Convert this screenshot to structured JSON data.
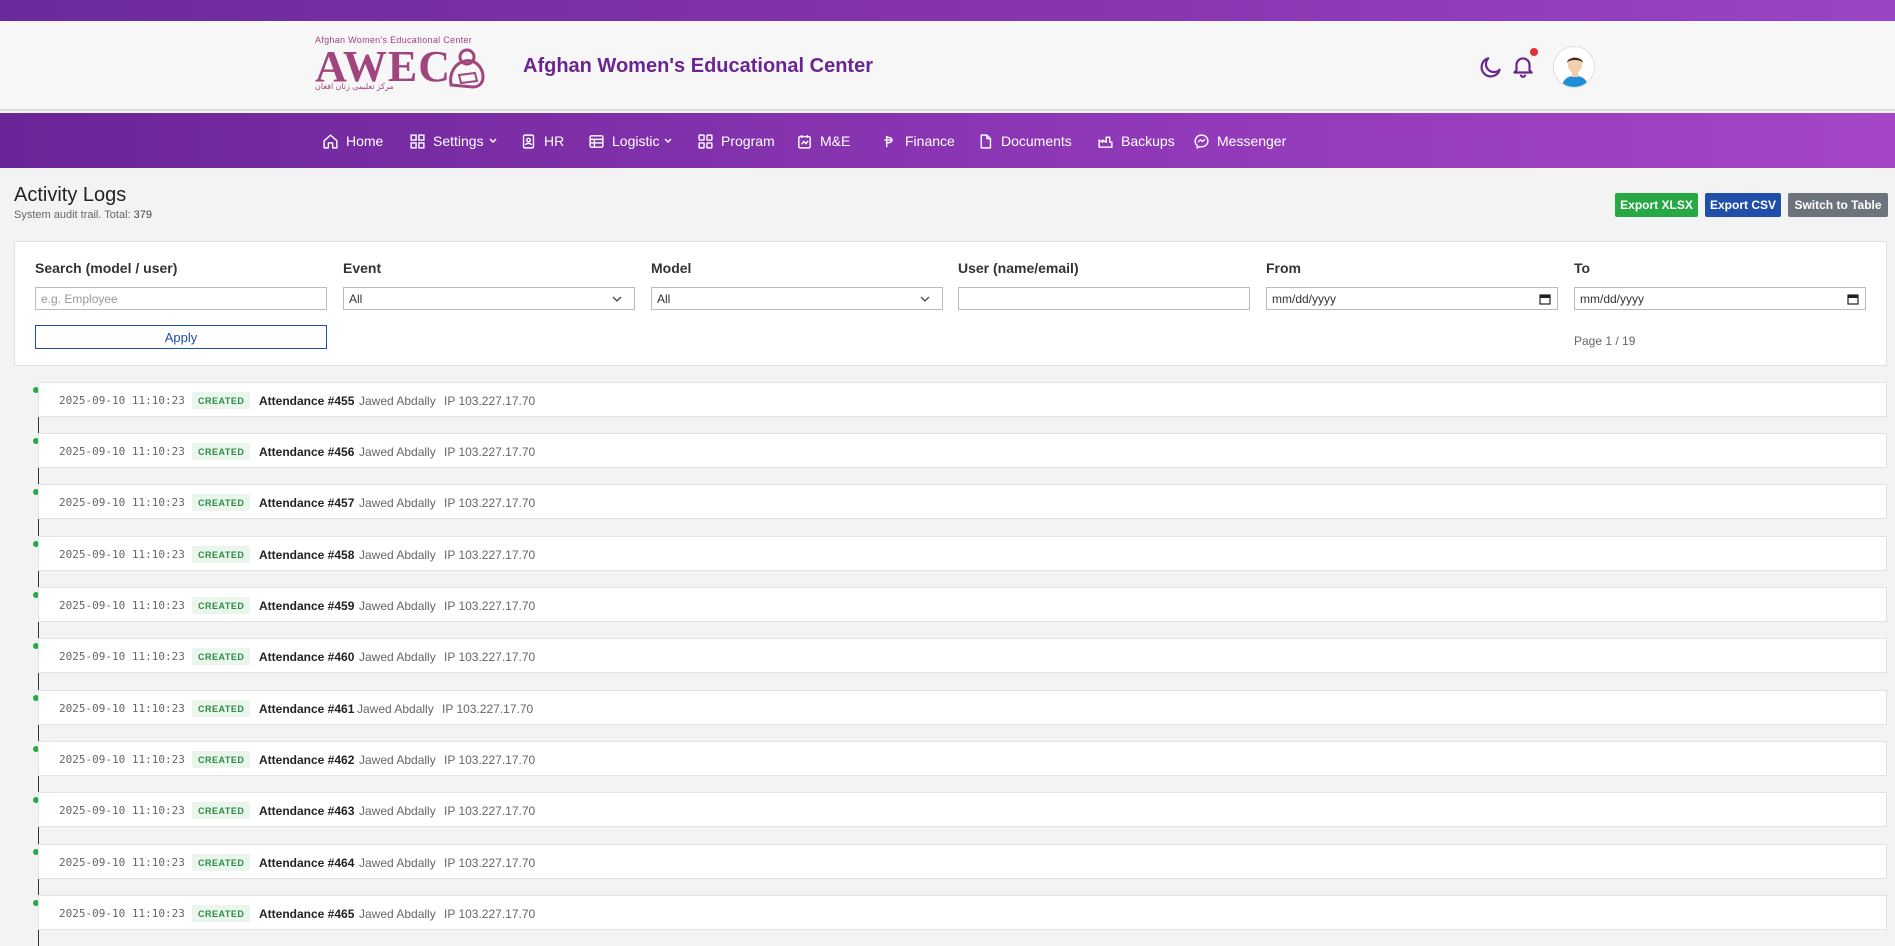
{
  "header": {
    "logo_small": "Afghan Women's Educational Center",
    "logo_big": "AWEC",
    "logo_arabic": "مرکز تعلیمی زنان افغان",
    "org_title": "Afghan Women's Educational Center"
  },
  "nav": [
    {
      "label": "Home",
      "icon": "home-icon"
    },
    {
      "label": "Settings",
      "icon": "grid-icon",
      "dropdown": true
    },
    {
      "label": "HR",
      "icon": "id-card-icon"
    },
    {
      "label": "Logistic",
      "icon": "table-icon",
      "dropdown": true
    },
    {
      "label": "Program",
      "icon": "grid-icon"
    },
    {
      "label": "M&E",
      "icon": "chart-icon"
    },
    {
      "label": "Finance",
      "icon": "currency-icon"
    },
    {
      "label": "Documents",
      "icon": "file-icon"
    },
    {
      "label": "Backups",
      "icon": "backup-icon"
    },
    {
      "label": "Messenger",
      "icon": "messenger-icon"
    }
  ],
  "page": {
    "title": "Activity Logs",
    "subtitle_prefix": "System audit trail. Total: ",
    "total": "379"
  },
  "actions": {
    "export_xlsx": "Export XLSX",
    "export_csv": "Export CSV",
    "switch_table": "Switch to Table"
  },
  "filters": {
    "search_label": "Search (model / user)",
    "search_placeholder": "e.g. Employee",
    "event_label": "Event",
    "event_value": "All",
    "model_label": "Model",
    "model_value": "All",
    "user_label": "User (name/email)",
    "user_value": "",
    "from_label": "From",
    "from_value": "mm/dd/yyyy",
    "to_label": "To",
    "to_value": "mm/dd/yyyy",
    "apply": "Apply",
    "page_info": "Page 1 / 19"
  },
  "logs": [
    {
      "ts": "2025-09-10 11:10:23",
      "event": "CREATED",
      "model": "Attendance #455",
      "user": "Jawed Abdally",
      "ip": "IP 103.227.17.70"
    },
    {
      "ts": "2025-09-10 11:10:23",
      "event": "CREATED",
      "model": "Attendance #456",
      "user": "Jawed Abdally",
      "ip": "IP 103.227.17.70"
    },
    {
      "ts": "2025-09-10 11:10:23",
      "event": "CREATED",
      "model": "Attendance #457",
      "user": "Jawed Abdally",
      "ip": "IP 103.227.17.70"
    },
    {
      "ts": "2025-09-10 11:10:23",
      "event": "CREATED",
      "model": "Attendance #458",
      "user": "Jawed Abdally",
      "ip": "IP 103.227.17.70"
    },
    {
      "ts": "2025-09-10 11:10:23",
      "event": "CREATED",
      "model": "Attendance #459",
      "user": "Jawed Abdally",
      "ip": "IP 103.227.17.70"
    },
    {
      "ts": "2025-09-10 11:10:23",
      "event": "CREATED",
      "model": "Attendance #460",
      "user": "Jawed Abdally",
      "ip": "IP 103.227.17.70"
    },
    {
      "ts": "2025-09-10 11:10:23",
      "event": "CREATED",
      "model": "Attendance #461",
      "user": "Jawed Abdally",
      "ip": "IP 103.227.17.70"
    },
    {
      "ts": "2025-09-10 11:10:23",
      "event": "CREATED",
      "model": "Attendance #462",
      "user": "Jawed Abdally",
      "ip": "IP 103.227.17.70"
    },
    {
      "ts": "2025-09-10 11:10:23",
      "event": "CREATED",
      "model": "Attendance #463",
      "user": "Jawed Abdally",
      "ip": "IP 103.227.17.70"
    },
    {
      "ts": "2025-09-10 11:10:23",
      "event": "CREATED",
      "model": "Attendance #464",
      "user": "Jawed Abdally",
      "ip": "IP 103.227.17.70"
    },
    {
      "ts": "2025-09-10 11:10:23",
      "event": "CREATED",
      "model": "Attendance #465",
      "user": "Jawed Abdally",
      "ip": "IP 103.227.17.70"
    }
  ],
  "colors": {
    "brand_purple": "#6b2590",
    "success_green": "#28a745",
    "primary_blue": "#1f4fa8",
    "secondary_gray": "#6c757d"
  }
}
